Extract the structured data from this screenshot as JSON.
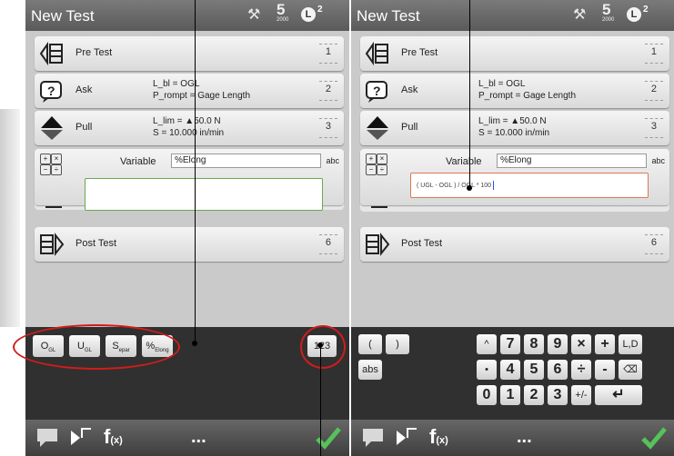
{
  "screens": [
    {
      "title": "New Test",
      "badge_s": "5",
      "badge_sub": "2000",
      "badge_l": "L",
      "badge_sup": "2",
      "rows": [
        {
          "label": "Pre Test",
          "num": "1"
        },
        {
          "label": "Ask",
          "num": "2",
          "desc1": "L_bl = OGL",
          "desc2": "P_rompt = Gage Length"
        },
        {
          "label": "Pull",
          "num": "3",
          "desc1": "L_lim = ▲50.0 N",
          "desc2": "S = 10.000 in/min"
        }
      ],
      "variable_label": "Variable",
      "variable_value": "%Elong",
      "abc": "abc",
      "post_label": "Post Test",
      "post_num": "6",
      "vars": [
        "O",
        "U",
        "S",
        "%"
      ],
      "vars_sub": [
        "GL",
        "GL",
        "epar",
        "Elong"
      ],
      "btn_123": "123",
      "fx": "f",
      "fx_sub": "(x)",
      "dots": "..."
    },
    {
      "title": "New Test",
      "badge_s": "5",
      "badge_sub": "2000",
      "badge_l": "L",
      "badge_sup": "2",
      "rows": [
        {
          "label": "Pre Test",
          "num": "1"
        },
        {
          "label": "Ask",
          "num": "2",
          "desc1": "L_bl = OGL",
          "desc2": "P_rompt = Gage Length"
        },
        {
          "label": "Pull",
          "num": "3",
          "desc1": "L_lim = ▲50.0 N",
          "desc2": "S = 10.000 in/min"
        }
      ],
      "variable_label": "Variable",
      "variable_value": "%Elong",
      "abc": "abc",
      "expression": "( UGL - OGL ) / OGL * 100",
      "post_label": "Post Test",
      "post_num": "6",
      "keys": [
        "(",
        ")",
        "^",
        "7",
        "8",
        "9",
        "×",
        "+",
        "L,D",
        "abs",
        "•",
        "4",
        "5",
        "6",
        "÷",
        "-",
        "⌫",
        "0",
        "1",
        "2",
        "3",
        "+/-",
        "↵"
      ],
      "fx": "f",
      "fx_sub": "(x)",
      "dots": "..."
    }
  ],
  "colors": {
    "ellipse": "#d11c1c",
    "check": "#55c25a",
    "expr_border_right": "#d97a55",
    "expr_border_left": "#6aa84f"
  }
}
